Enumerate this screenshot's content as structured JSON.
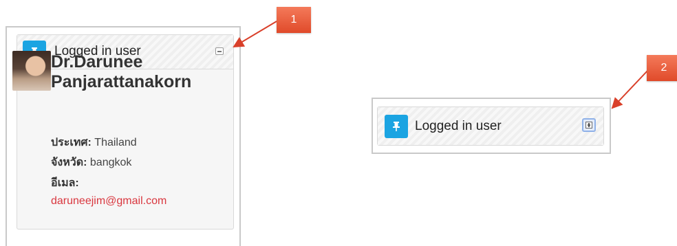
{
  "annotations": {
    "badge_1": "1",
    "badge_2": "2",
    "color": "#d9402a"
  },
  "block_expanded": {
    "title": "Logged in user",
    "icon": "pin-icon",
    "toggle_icon": "collapse-icon",
    "user": {
      "name_line1": "Dr.Darunee",
      "name_line2": "Panjarattanakorn",
      "country_label": "ประเทศ:",
      "country_value": "Thailand",
      "province_label": "จังหวัด:",
      "province_value": "bangkok",
      "email_label": "อีเมล:",
      "email_value": "daruneejim@gmail.com"
    }
  },
  "block_collapsed": {
    "title": "Logged in user",
    "icon": "pin-icon",
    "toggle_icon": "expand-icon"
  },
  "colors": {
    "pin_bg": "#1ba4e2",
    "link": "#d9363e"
  }
}
